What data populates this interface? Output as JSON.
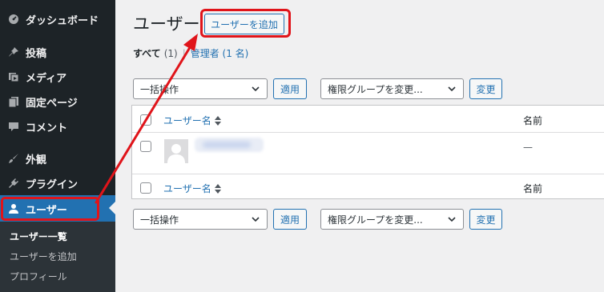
{
  "sidebar": {
    "items": [
      {
        "label": "ダッシュボード",
        "icon": "dashboard-icon"
      },
      {
        "label": "投稿",
        "icon": "pin-icon"
      },
      {
        "label": "メディア",
        "icon": "media-icon"
      },
      {
        "label": "固定ページ",
        "icon": "page-icon"
      },
      {
        "label": "コメント",
        "icon": "comment-icon"
      },
      {
        "label": "外観",
        "icon": "brush-icon"
      },
      {
        "label": "プラグイン",
        "icon": "plugin-icon"
      },
      {
        "label": "ユーザー",
        "icon": "user-icon"
      }
    ],
    "active": "ユーザー",
    "submenu": [
      "ユーザー一覧",
      "ユーザーを追加",
      "プロフィール"
    ],
    "submenu_current": "ユーザー一覧"
  },
  "header": {
    "title": "ユーザー",
    "add_button": "ユーザーを追加"
  },
  "filters": {
    "all_label": "すべて",
    "all_count": "(1)",
    "separator": "|",
    "admin_label": "管理者 (1 名)"
  },
  "top_actions": {
    "bulk_select": "一括操作",
    "apply": "適用",
    "role_select": "権限グループを変更...",
    "change": "変更"
  },
  "table": {
    "columns": {
      "username": "ユーザー名",
      "name": "名前"
    },
    "rows": [
      {
        "username": "",
        "name": "—"
      }
    ]
  },
  "bottom_actions": {
    "bulk_select": "一括操作",
    "apply": "適用",
    "role_select": "権限グループを変更...",
    "change": "変更"
  },
  "colors": {
    "sidebar_bg": "#1d2327",
    "accent": "#2271b1",
    "highlight": "#e0141a"
  }
}
